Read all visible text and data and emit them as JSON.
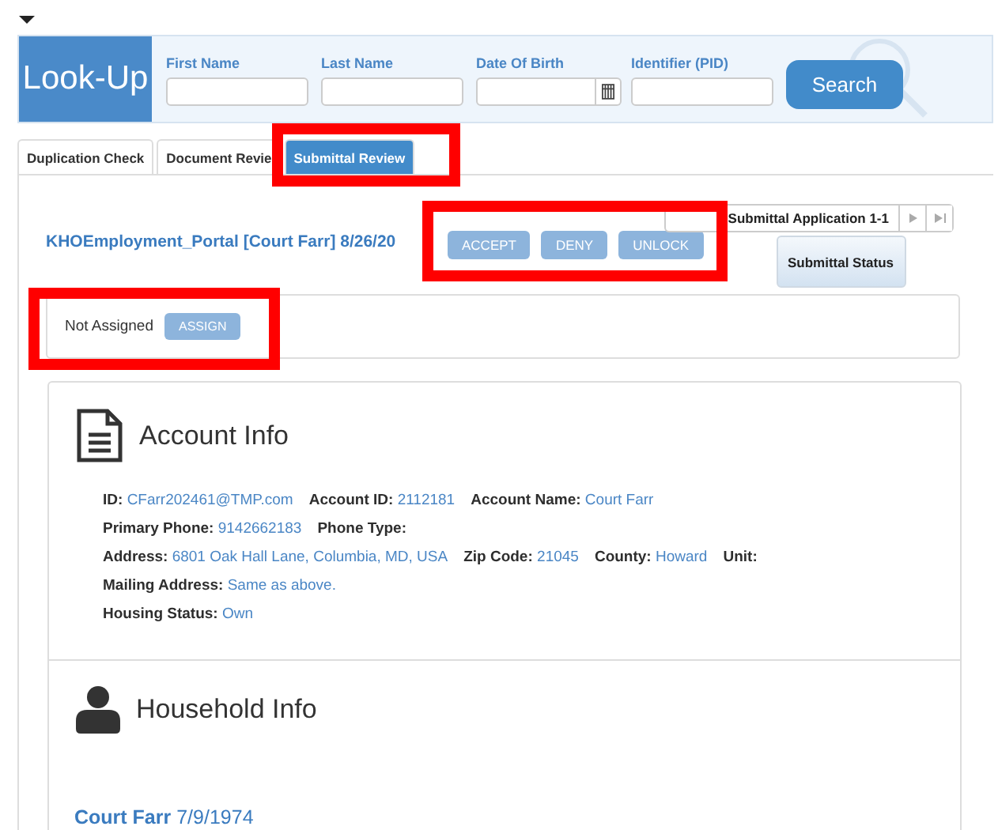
{
  "lookup": {
    "title": "Look-Up",
    "fields": [
      {
        "label": "First Name",
        "kind": "text"
      },
      {
        "label": "Last Name",
        "kind": "text"
      },
      {
        "label": "Date Of Birth",
        "kind": "date"
      },
      {
        "label": "Identifier (PID)",
        "kind": "text"
      }
    ],
    "search_button": "Search"
  },
  "tabs": [
    {
      "label": "Duplication Check",
      "selected": false
    },
    {
      "label": "Document Revie",
      "selected": false
    },
    {
      "label": "Submittal Review",
      "selected": true
    }
  ],
  "submittal": {
    "title": "KHOEmployment_Portal [Court Farr] 8/26/20",
    "actions": [
      "ACCEPT",
      "DENY",
      "UNLOCK"
    ],
    "pager": "Submittal Application 1-1",
    "status_button": "Submittal Status"
  },
  "assignment": {
    "status": "Not Assigned",
    "button": "ASSIGN"
  },
  "account": {
    "heading": "Account Info",
    "lines": [
      [
        {
          "label": "ID:",
          "value": "CFarr202461@TMP.com"
        },
        {
          "label": "Account ID:",
          "value": "2112181"
        },
        {
          "label": "Account Name:",
          "value": "Court Farr"
        }
      ],
      [
        {
          "label": "Primary Phone:",
          "value": "9142662183"
        },
        {
          "label": "Phone Type:"
        }
      ],
      [
        {
          "label": "Address:",
          "value": "6801 Oak Hall Lane, Columbia, MD, USA"
        },
        {
          "label": "Zip Code:",
          "value": "21045"
        },
        {
          "label": "County:",
          "value": "Howard"
        },
        {
          "label": "Unit:"
        }
      ],
      [
        {
          "label": "Mailing Address:",
          "value": "Same as above."
        }
      ],
      [
        {
          "label": "Housing Status:",
          "value": "Own"
        }
      ]
    ]
  },
  "household": {
    "heading": "Household Info",
    "members": [
      {
        "name": "Court Farr",
        "dob": "7/9/1974"
      }
    ]
  },
  "highlights": [
    {
      "kind": "tab"
    },
    {
      "kind": "actions"
    },
    {
      "kind": "assign"
    }
  ]
}
